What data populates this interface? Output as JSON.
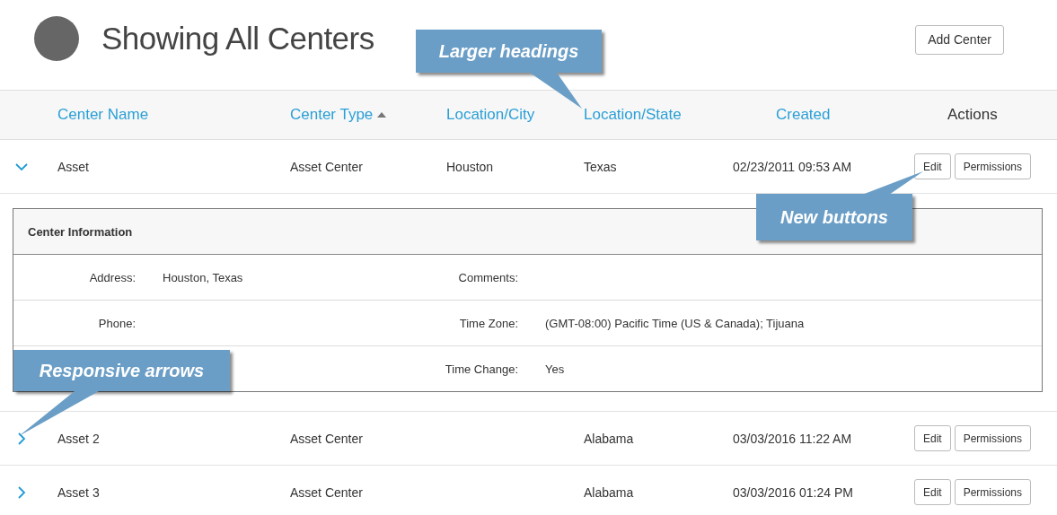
{
  "page": {
    "title": "Showing All Centers",
    "add_button": "Add Center"
  },
  "table": {
    "columns": [
      {
        "label": "Center Name",
        "sortable": true,
        "sorted": false
      },
      {
        "label": "Center Type",
        "sortable": true,
        "sorted": true
      },
      {
        "label": "Location/City",
        "sortable": true,
        "sorted": false
      },
      {
        "label": "Location/State",
        "sortable": true,
        "sorted": false
      },
      {
        "label": "Created",
        "sortable": true,
        "sorted": false
      },
      {
        "label": "Actions",
        "sortable": false,
        "sorted": false
      }
    ],
    "rows": [
      {
        "expanded": true,
        "name": "Asset",
        "type": "Asset Center",
        "city": "Houston",
        "state": "Texas",
        "created": "02/23/2011 09:53 AM",
        "actions": [
          "Edit",
          "Permissions"
        ],
        "details": {
          "title": "Center Information",
          "rows": [
            {
              "label_1": "Address:",
              "value_1": "Houston, Texas",
              "label_2": "Comments:"
            },
            {
              "label_1": "Phone:",
              "label_2": "Time Zone:",
              "value_2": "(GMT-08:00) Pacific Time (US & Canada); Tijuana"
            },
            {
              "label_2": "Time Change:",
              "value_2": "Yes"
            }
          ]
        }
      },
      {
        "expanded": false,
        "name": "Asset 2",
        "type": "Asset Center",
        "state": "Alabama",
        "created": "03/03/2016 11:22 AM",
        "actions": [
          "Edit",
          "Permissions"
        ]
      },
      {
        "expanded": false,
        "name": "Asset 3",
        "type": "Asset Center",
        "state": "Alabama",
        "created": "03/03/2016 01:24 PM",
        "actions": [
          "Edit",
          "Permissions"
        ]
      }
    ]
  },
  "callouts": [
    {
      "text": "Larger headings"
    },
    {
      "text": "New buttons"
    },
    {
      "text": "Responsive arrows"
    }
  ]
}
